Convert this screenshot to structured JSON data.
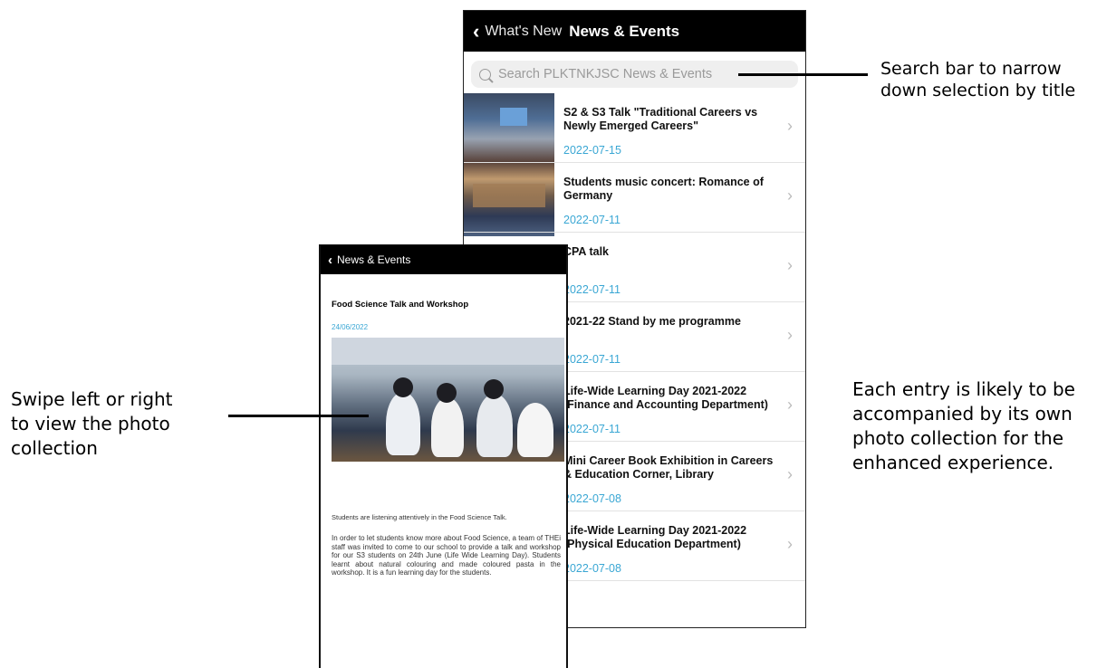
{
  "back_screen": {
    "header": {
      "back_label": "What's New",
      "title": "News & Events"
    },
    "search": {
      "placeholder": "Search PLKTNKJSC News & Events"
    },
    "items": [
      {
        "title": "S2 & S3 Talk \"Traditional Careers vs Newly Emerged Careers\"",
        "date": "2022-07-15"
      },
      {
        "title": "Students music concert: Romance of Germany",
        "date": "2022-07-11"
      },
      {
        "title": "CPA talk",
        "date": "2022-07-11"
      },
      {
        "title": "2021-22 Stand by me programme",
        "date": "2022-07-11"
      },
      {
        "title": "Life-Wide Learning Day 2021-2022 (Finance and Accounting Department)",
        "date": "2022-07-11"
      },
      {
        "title": "Mini Career Book Exhibition in Careers & Education Corner, Library",
        "date": "2022-07-08"
      },
      {
        "title": "Life-Wide Learning Day 2021-2022 (Physical Education Department)",
        "date": "2022-07-08"
      }
    ]
  },
  "front_screen": {
    "header": {
      "back_label": "News & Events"
    },
    "title": "Food Science Talk and Workshop",
    "date": "24/06/2022",
    "caption": "Students are listening attentively in the Food Science Talk.",
    "body": "In order to let students know more about Food Science, a team of THEi staff was invited to come to our school to provide a talk and workshop for our S3 students on 24th June (Life Wide Learning Day). Students learnt about natural colouring and made coloured pasta in the workshop. It is a fun learning day for the students."
  },
  "annotations": {
    "search": [
      "Search bar to narrow",
      "down selection by title"
    ],
    "swipe": [
      "Swipe left or right",
      "to view the photo",
      "collection"
    ],
    "entry": [
      "Each entry is likely to be",
      "accompanied by its own",
      "photo collection for the",
      "enhanced experience."
    ]
  },
  "icons": {
    "back": "chevron-left-icon",
    "search": "search-icon",
    "row": "chevron-right-icon"
  }
}
